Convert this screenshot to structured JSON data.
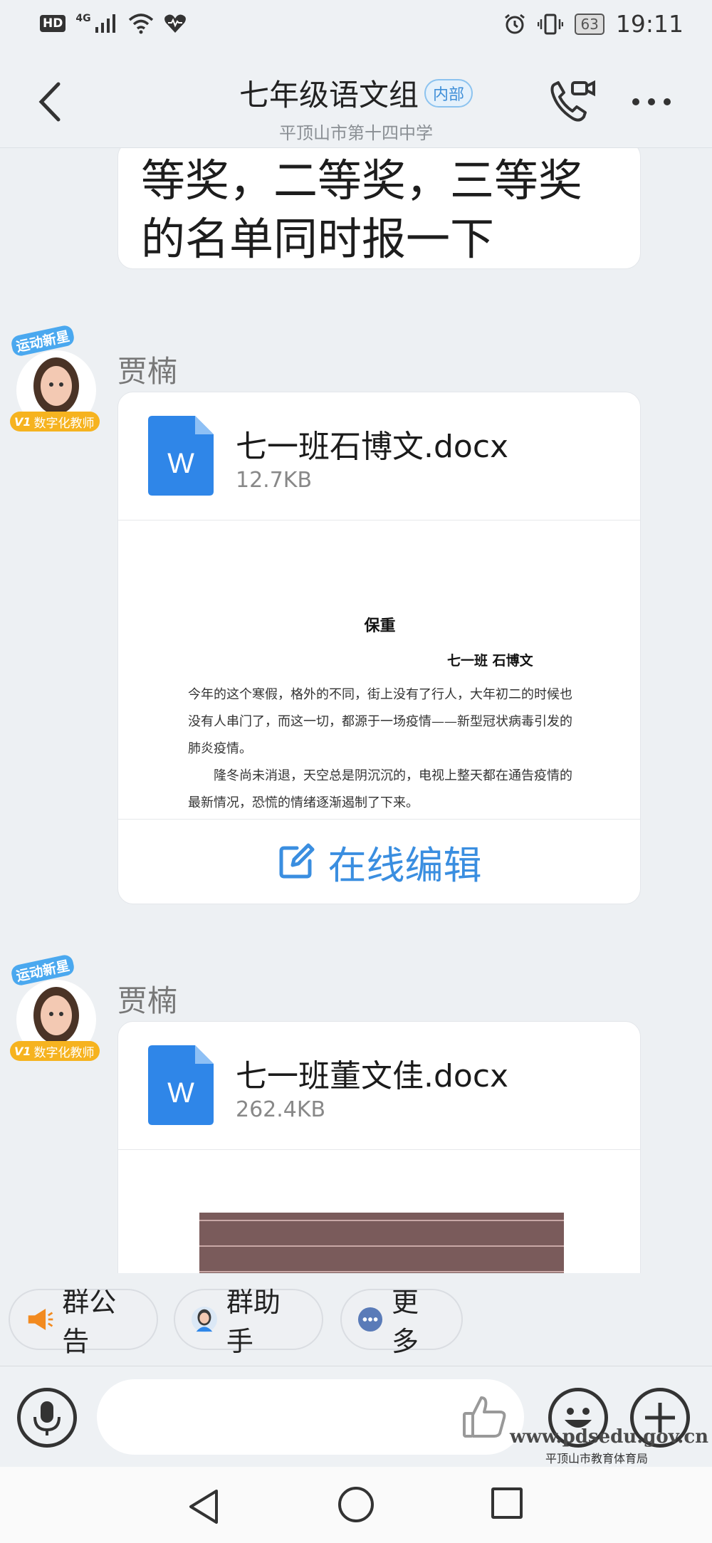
{
  "status_bar": {
    "hd": "HD",
    "network": "4G",
    "battery": "63",
    "time": "19:11"
  },
  "header": {
    "title": "七年级语文组",
    "badge": "内部",
    "subtitle": "平顶山市第十四中学"
  },
  "messages": {
    "first_text": "等奖，二等奖，三等奖的名单同时报一下",
    "avatar_badge_top": "运动新星",
    "avatar_badge_bottom": "数字化教师",
    "avatar_v": "V1",
    "file1": {
      "sender": "贾楠",
      "name": "七一班石博文.docx",
      "size": "12.7KB",
      "icon_letter": "W",
      "preview_title": "保重",
      "preview_author": "七一班  石博文",
      "preview_p1": "今年的这个寒假，格外的不同，街上没有了行人，大年初二的时候也没有人串门了，而这一切，都源于一场疫情——新型冠状病毒引发的肺炎疫情。",
      "preview_p2": "隆冬尚未消退，天空总是阴沉沉的，电视上整天都在通告疫情的最新情况，恐慌的情绪逐渐遏制了下来。",
      "edit_label": "在线编辑"
    },
    "file2": {
      "sender": "贾楠",
      "name": "七一班董文佳.docx",
      "size": "262.4KB",
      "icon_letter": "W"
    }
  },
  "quick_actions": {
    "announcement": "群公告",
    "assistant": "群助手",
    "more": "更多"
  },
  "watermark": {
    "url": "www.pdsedu.gov.cn",
    "org": "平顶山市教育体育局"
  },
  "colors": {
    "accent": "#3a8ee0",
    "word_blue": "#2f86e8",
    "background": "#edf0f3"
  }
}
